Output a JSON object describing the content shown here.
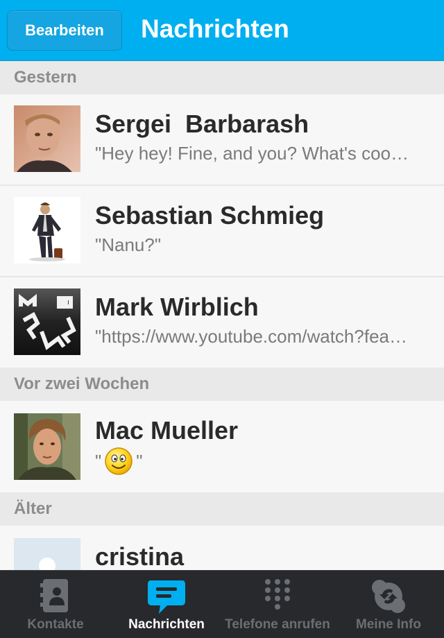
{
  "navbar": {
    "edit_label": "Bearbeiten",
    "title": "Nachrichten",
    "color": "#00aff0"
  },
  "sections": [
    {
      "header": "Gestern",
      "conversations": [
        {
          "name": "Sergei  Barbarash",
          "preview": "\"Hey hey! Fine, and you? What's coo…",
          "avatar": "photo-man-portrait"
        },
        {
          "name": "Sebastian Schmieg",
          "preview": "\"Nanu?\"",
          "avatar": "figure-with-suitcase"
        },
        {
          "name": "Mark Wirblich",
          "preview": "\"https://www.youtube.com/watch?fea…",
          "avatar": "meew-logo"
        }
      ]
    },
    {
      "header": "Vor zwei Wochen",
      "conversations": [
        {
          "name": "Mac Mueller",
          "preview_prefix": "\"",
          "preview_suffix": "\"",
          "preview_emoji": "smiley-icon",
          "avatar": "photo-man-forest"
        }
      ]
    },
    {
      "header": "Älter",
      "conversations": [
        {
          "name": "cristina",
          "avatar": "default-avatar-icon"
        }
      ]
    }
  ],
  "tabbar": {
    "tabs": [
      {
        "label": "Kontakte",
        "icon": "contacts-icon",
        "active": false
      },
      {
        "label": "Nachrichten",
        "icon": "chat-bubble-icon",
        "active": true
      },
      {
        "label": "Telefone anrufen",
        "icon": "dialpad-icon",
        "active": false
      },
      {
        "label": "Meine Info",
        "icon": "skype-sync-icon",
        "active": false
      }
    ],
    "active_color": "#00aff0"
  }
}
